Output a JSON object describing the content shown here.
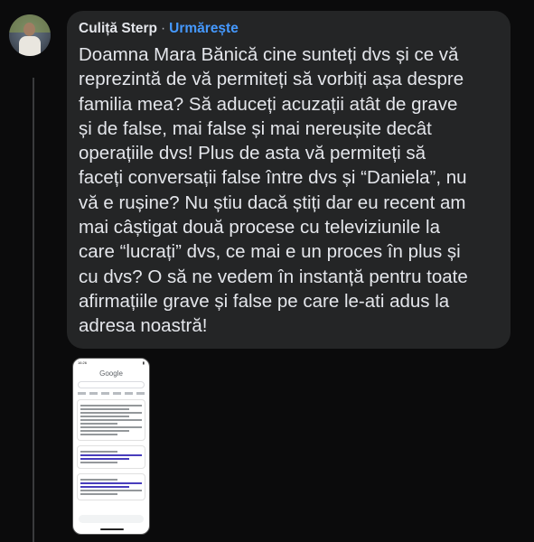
{
  "comment": {
    "author": "Culiță Sterp",
    "separator": "·",
    "follow_label": "Urmărește",
    "text_lines": [
      "Doamna Mara Bănică cine sunteți dvs și ce vă",
      "reprezintă de vă permiteți să vorbiți așa despre",
      "familia mea? Să aduceți acuzații atât de grave",
      "și de false, mai false și mai nereușite decât",
      "operațiile dvs! Plus de asta vă permiteți să",
      "faceți conversații false între dvs și “Daniela”, nu",
      "vă e rușine? Nu știu dacă știți dar eu recent am",
      "mai câștigat două procese cu televiziunile la",
      "care “lucrați” dvs, ce mai e un proces în plus și",
      "cu dvs? O să ne vedem în instanță pentru toate",
      "afirmațiile grave și false pe care le-ati adus la",
      "adresa noastră!"
    ]
  },
  "attachment": {
    "status_time": "16:26",
    "logo": "Google"
  },
  "colors": {
    "background": "#0b0b0c",
    "bubble": "#242526",
    "text": "#e4e6eb",
    "follow": "#4599ff"
  }
}
